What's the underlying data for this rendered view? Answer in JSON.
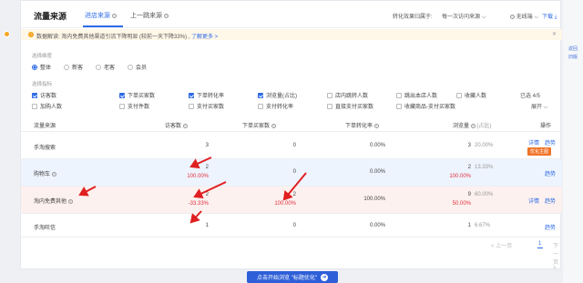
{
  "header": {
    "title": "流量来源",
    "tabs": [
      {
        "label": "进店来源"
      },
      {
        "label": "上一跳来源"
      }
    ],
    "effect_label": "转化效果归属于:",
    "effect_value": "每一次访问来源",
    "device_value": "无线端",
    "download_label": "下载"
  },
  "notice": {
    "text": "数据解读: 淘内免费其他渠道引流下降明显 (较前一天下降33%) ,",
    "link": "了解更多 >"
  },
  "filters": {
    "dimension_label": "选择维度",
    "dimension_options": [
      {
        "label": "整体",
        "selected": true
      },
      {
        "label": "新客",
        "selected": false
      },
      {
        "label": "老客",
        "selected": false
      },
      {
        "label": "会员",
        "selected": false
      }
    ],
    "metrics_label": "选择指标",
    "metrics": [
      {
        "label": "访客数",
        "checked": true
      },
      {
        "label": "下单买家数",
        "checked": true
      },
      {
        "label": "下单转化率",
        "checked": true
      },
      {
        "label": "浏览量(占比)",
        "checked": true
      },
      {
        "label": "店内跳转人数",
        "checked": false
      },
      {
        "label": "跳出本店人数",
        "checked": false
      },
      {
        "label": "收藏人数",
        "checked": false
      },
      {
        "label": "加购人数",
        "checked": false
      },
      {
        "label": "支付件数",
        "checked": false
      },
      {
        "label": "支付买家数",
        "checked": false
      },
      {
        "label": "支付转化率",
        "checked": false
      },
      {
        "label": "直接支付买家数",
        "checked": false
      },
      {
        "label": "收藏商品-支付买家数",
        "checked": false
      }
    ],
    "selected_count": "已选 4/5",
    "expand_label": "展开"
  },
  "table": {
    "headers": [
      "流量来源",
      "访客数",
      "下单买家数",
      "下单转化率",
      "浏览量",
      "(占比)",
      "操作"
    ],
    "rows": [
      {
        "source": "手淘搜索",
        "visitors": "3",
        "visitors_change": "",
        "buyers": "0",
        "buyers_change": "",
        "conv": "0.00%",
        "pv": "3",
        "pv_change": "",
        "share": "20.00%",
        "ops": [
          "详情",
          "趋势"
        ],
        "badge": "优化主图"
      },
      {
        "source": "购物车",
        "visitors": "2",
        "visitors_change": "100.00%",
        "buyers": "0",
        "buyers_change": "",
        "conv": "0.00%",
        "pv": "2",
        "pv_change": "100.00%",
        "share": "13.33%",
        "ops": [
          "趋势"
        ],
        "badge": ""
      },
      {
        "source": "淘内免费其他",
        "visitors": "2",
        "visitors_change": "-33.33%",
        "buyers": "2",
        "buyers_change": "100.00%",
        "conv": "100.00%",
        "pv": "9",
        "pv_change": "50.00%",
        "share": "60.00%",
        "ops": [
          "详情",
          "趋势"
        ],
        "badge": ""
      },
      {
        "source": "手淘旺信",
        "visitors": "1",
        "visitors_change": "",
        "buyers": "0",
        "buyers_change": "",
        "conv": "0.00%",
        "pv": "1",
        "pv_change": "",
        "share": "6.67%",
        "ops": [
          "趋势"
        ],
        "badge": ""
      }
    ]
  },
  "pager": {
    "prev": "< 上一页",
    "current": "1",
    "next": "下一页 >"
  },
  "cta": {
    "label": "点击开始浏览 \"标题优化\"",
    "arrow": "➜"
  },
  "side": {
    "links": [
      "返回",
      "旧版"
    ]
  },
  "colors": {
    "accent": "#2e6be6",
    "alert": "#e0303a",
    "badge": "#f0742a",
    "notice_bg": "#fff7e8"
  }
}
